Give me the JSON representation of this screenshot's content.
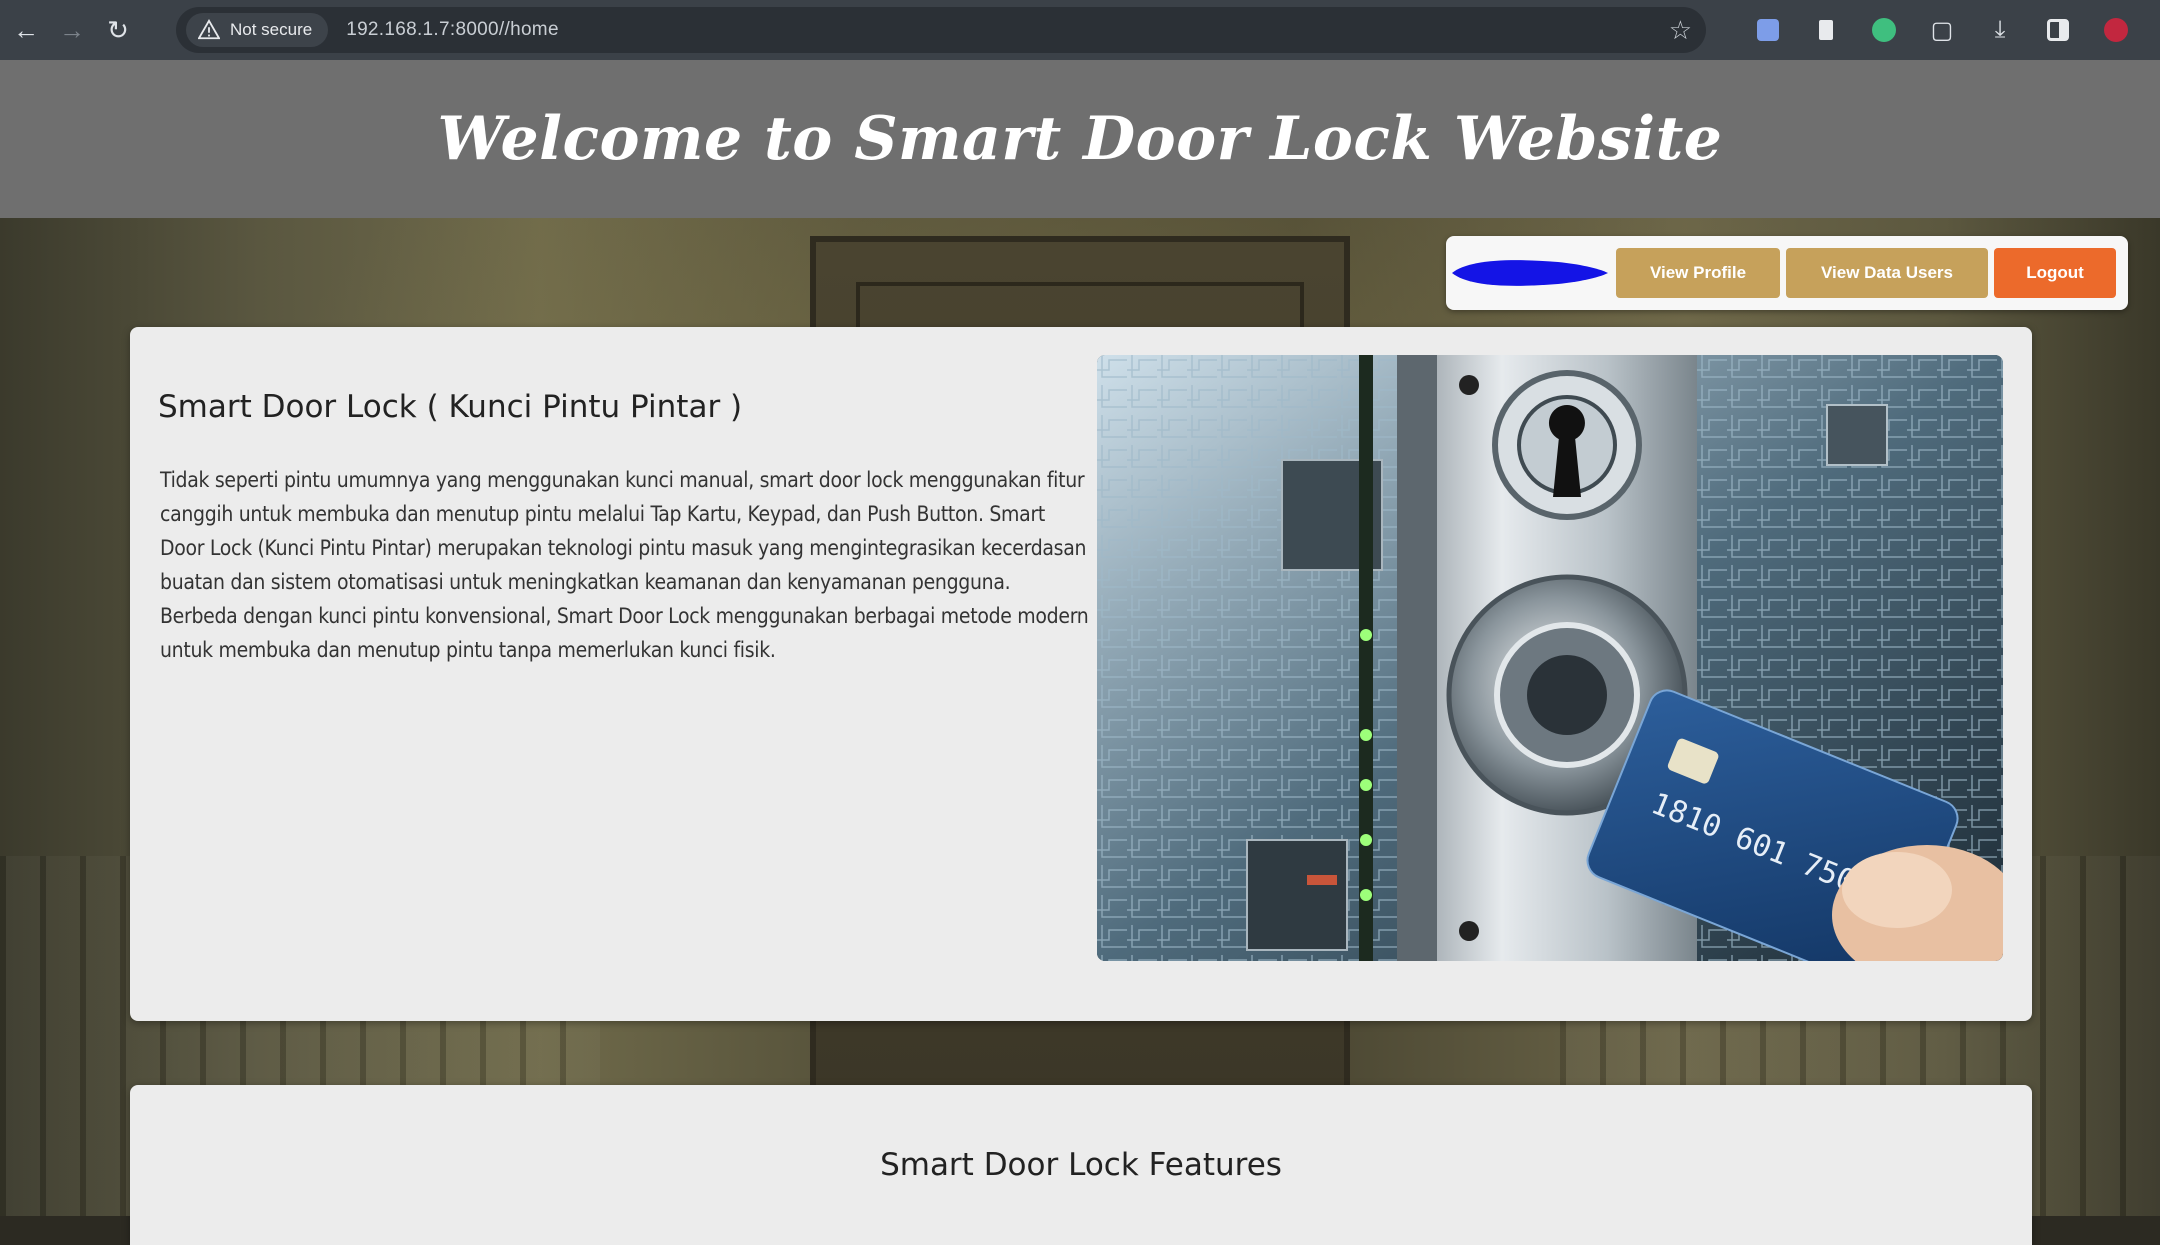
{
  "browser": {
    "security_label": "Not secure",
    "url": "192.168.1.7:8000//home"
  },
  "header": {
    "title": "Welcome to Smart Door Lock Website"
  },
  "nav": {
    "view_profile": "View Profile",
    "view_data_users": "View Data Users",
    "logout": "Logout"
  },
  "intro": {
    "heading": "Smart Door Lock ( Kunci Pintu Pintar )",
    "body": "Tidak seperti pintu umumnya yang menggunakan kunci manual, smart door lock menggunakan fitur canggih untuk membuka dan menutup pintu melalui Tap Kartu, Keypad, dan Push Button. Smart Door Lock (Kunci Pintu Pintar) merupakan teknologi pintu masuk yang mengintegrasikan kecerdasan buatan dan sistem otomatisasi untuk meningkatkan keamanan dan kenyamanan pengguna. Berbeda dengan kunci pintu konvensional, Smart Door Lock menggunakan berbagai metode modern untuk membuka dan menutup pintu tanpa memerlukan kunci fisik."
  },
  "features": {
    "heading": "Smart Door Lock Features"
  },
  "colors": {
    "title_bar": "#6f6f6f",
    "button_gold": "#c6a15b",
    "button_logout": "#ec6a2b",
    "blob_link": "#1414e6"
  }
}
